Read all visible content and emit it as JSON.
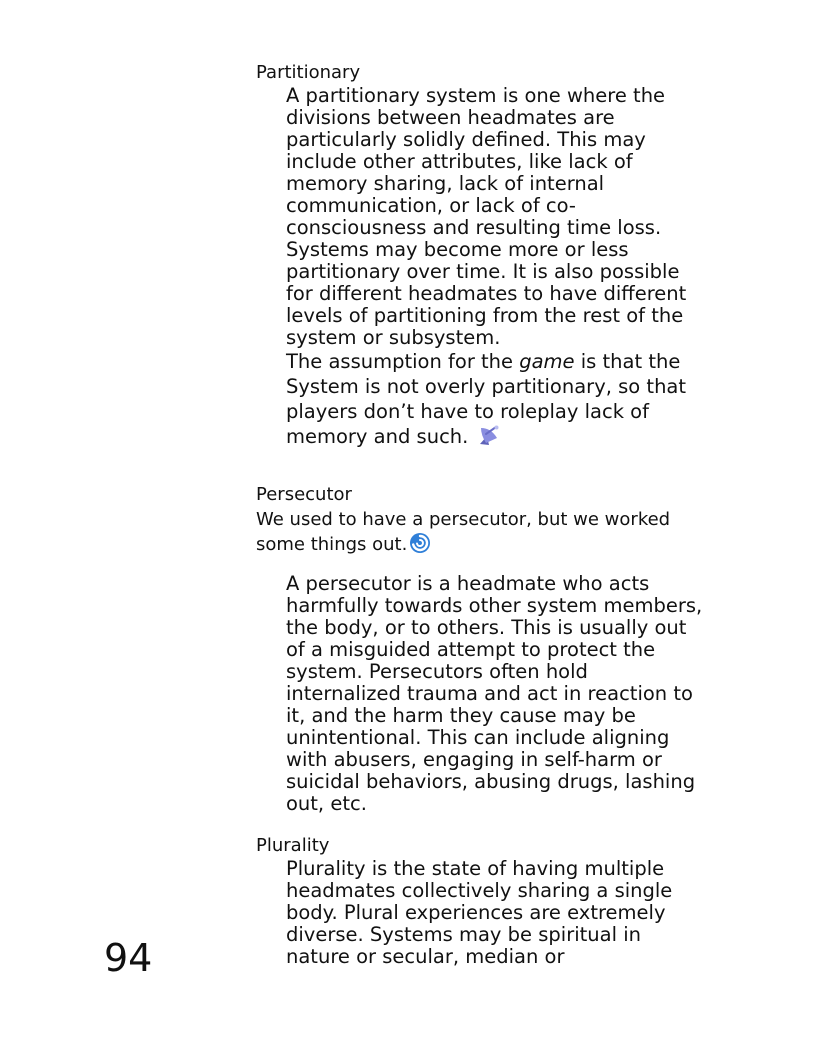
{
  "entries": {
    "partitionary": {
      "term": "Partitionary",
      "definition": "A partitionary system is one where the divisions between headmates are particularly solidly defined. This may include other attributes, like lack of memory sharing, lack of internal communication, or lack of co-consciousness and resulting time loss. Systems may become more or less partitionary over time. It is also possible for different headmates to have different levels of partitioning from the rest of the system or subsystem.",
      "note_before": "The assumption for the ",
      "note_emphasis": "game",
      "note_after": " is that the System is not overly partitionary, so that players don’t have to roleplay lack of memory and such.",
      "note_icon": "satellite-dish-icon"
    },
    "persecutor": {
      "term": "Persecutor",
      "quote": "We used to have a persecutor, but we worked some things out.",
      "quote_icon": "swirl-icon",
      "definition": "A persecutor is a headmate who acts harmfully towards other system members, the body, or to others. This is usually out of a misguided attempt to protect the system. Persecutors often hold internalized trauma and act in reaction to it, and the harm they cause may be unintentional. This can include aligning with abusers, engaging in self-harm or suicidal behaviors, abusing drugs, lashing out, etc."
    },
    "plurality": {
      "term": "Plurality",
      "definition": "Plurality is the state of having multiple headmates collectively sharing a single body. Plural experiences are extremely diverse. Systems may be spiritual in nature or secular, median or"
    }
  },
  "page_number": "94",
  "colors": {
    "text": "#111111",
    "icon_dish": "#7b7fd6",
    "icon_swirl": "#2f7fd8"
  }
}
